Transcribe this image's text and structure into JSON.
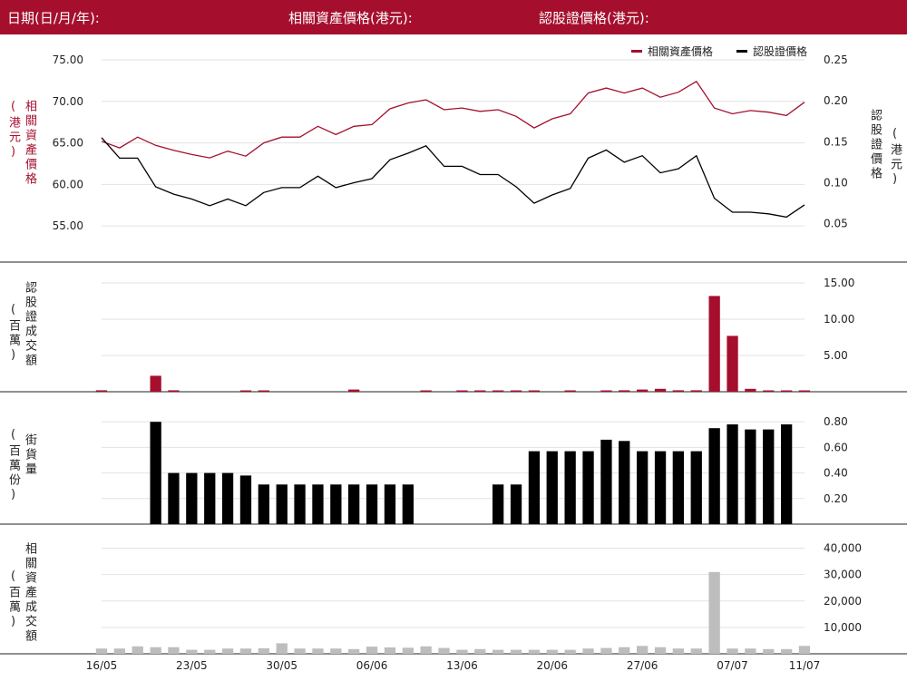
{
  "header": {
    "date_label": "日期(日/月/年):",
    "asset_price_label": "相關資產價格(港元):",
    "warrant_price_label": "認股證價格(港元):"
  },
  "legend": {
    "asset": "相關資產價格",
    "warrant": "認股證價格"
  },
  "axis_labels": {
    "price_left": "相關資產價格",
    "price_left_unit": "(港元)",
    "price_right": "認股證價格",
    "price_right_unit": "(港元)",
    "warrant_turnover": "認股證成交額",
    "warrant_turnover_unit": "(百萬)",
    "outstanding": "街貨量",
    "outstanding_unit": "(百萬份)",
    "asset_turnover": "相關資產成交額",
    "asset_turnover_unit": "(百萬)"
  },
  "colors": {
    "brand": "#a50f2d",
    "warrant_line": "#000000",
    "outstanding_bar": "#000000",
    "asset_turnover_bar": "#bdbdbd"
  },
  "chart_data": [
    {
      "type": "line",
      "x_tick_labels": [
        "16/05",
        "23/05",
        "30/05",
        "06/06",
        "13/06",
        "20/06",
        "27/06",
        "07/07",
        "11/07"
      ],
      "x_tick_index": [
        0,
        5,
        10,
        15,
        20,
        25,
        30,
        35,
        39
      ],
      "series": [
        {
          "name": "相關資產價格",
          "axis": "left",
          "values": [
            65.2,
            64.4,
            65.7,
            64.7,
            64.1,
            63.6,
            63.2,
            64.0,
            63.4,
            65.0,
            65.7,
            65.7,
            67.0,
            66.0,
            67.0,
            67.2,
            69.1,
            69.8,
            70.2,
            69.0,
            69.2,
            68.8,
            69.0,
            68.2,
            66.8,
            67.9,
            68.5,
            71.0,
            71.6,
            71.0,
            71.6,
            70.5,
            71.1,
            72.4,
            69.2,
            68.5,
            68.9,
            68.7,
            68.3,
            69.9
          ]
        },
        {
          "name": "認股證價格",
          "axis": "right",
          "values": [
            0.155,
            0.13,
            0.13,
            0.095,
            0.086,
            0.08,
            0.072,
            0.08,
            0.072,
            0.088,
            0.094,
            0.094,
            0.108,
            0.094,
            0.1,
            0.105,
            0.128,
            0.136,
            0.145,
            0.12,
            0.12,
            0.11,
            0.11,
            0.095,
            0.075,
            0.085,
            0.093,
            0.13,
            0.14,
            0.125,
            0.133,
            0.112,
            0.117,
            0.133,
            0.081,
            0.064,
            0.064,
            0.062,
            0.058,
            0.073
          ]
        }
      ],
      "y_left_ticks": [
        "75.00",
        "70.00",
        "65.00",
        "60.00",
        "55.00"
      ],
      "y_left_range": [
        53.6,
        75.0
      ],
      "y_right_ticks": [
        "0.25",
        "0.20",
        "0.15",
        "0.10",
        "0.05"
      ],
      "y_right_range": [
        0.033,
        0.25
      ]
    },
    {
      "type": "bar",
      "name": "認股證成交額",
      "values": [
        0.2,
        0,
        0,
        2.2,
        0.2,
        0,
        0,
        0,
        0.1,
        0.1,
        0,
        0,
        0,
        0,
        0.3,
        0,
        0,
        0,
        0.1,
        0,
        0.1,
        0.1,
        0.1,
        0.1,
        0.1,
        0,
        0.1,
        0,
        0.1,
        0.2,
        0.3,
        0.4,
        0.2,
        0.2,
        13.2,
        7.7,
        0.4,
        0.1,
        0.1,
        0.1
      ],
      "y_ticks": [
        "15.00",
        "10.00",
        "5.00"
      ],
      "y_range": [
        0,
        16.5
      ]
    },
    {
      "type": "bar",
      "name": "街貨量",
      "values": [
        0,
        0,
        0,
        0.8,
        0.4,
        0.4,
        0.4,
        0.4,
        0.38,
        0.31,
        0.31,
        0.31,
        0.31,
        0.31,
        0.31,
        0.31,
        0.31,
        0.31,
        0,
        0,
        0,
        0,
        0.31,
        0.31,
        0.57,
        0.57,
        0.57,
        0.57,
        0.66,
        0.65,
        0.57,
        0.57,
        0.57,
        0.57,
        0.75,
        0.78,
        0.74,
        0.74,
        0.78,
        0
      ],
      "y_ticks": [
        "0.80",
        "0.60",
        "0.40",
        "0.20"
      ],
      "y_range": [
        0,
        0.95
      ]
    },
    {
      "type": "bar",
      "name": "相關資產成交額",
      "values": [
        2000,
        2000,
        2800,
        2500,
        2500,
        1500,
        1500,
        2000,
        2000,
        2100,
        4000,
        2000,
        2000,
        2000,
        1800,
        2700,
        2400,
        2300,
        2800,
        2200,
        1500,
        1800,
        1500,
        1500,
        1500,
        1500,
        1500,
        2000,
        2200,
        2500,
        3000,
        2500,
        2000,
        2000,
        31000,
        2000,
        2000,
        1800,
        1800,
        3000
      ],
      "y_ticks": [
        "40,000",
        "30,000",
        "20,000",
        "10,000"
      ],
      "y_range": [
        0,
        45000
      ]
    }
  ]
}
